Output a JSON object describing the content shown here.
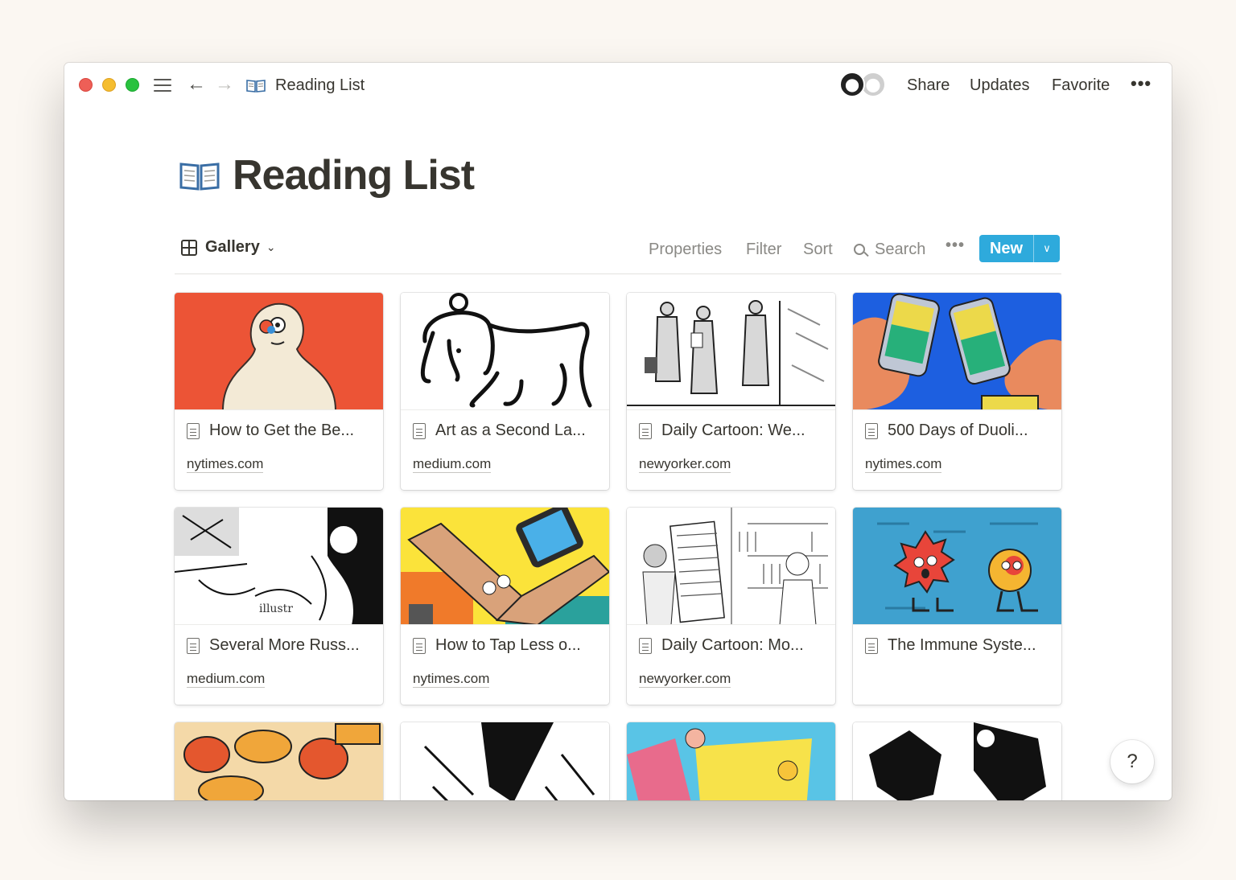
{
  "window": {
    "breadcrumb": "Reading List",
    "top_links": {
      "share": "Share",
      "updates": "Updates",
      "favorite": "Favorite"
    }
  },
  "page": {
    "title": "Reading List",
    "icon": "open-book-icon"
  },
  "toolbar": {
    "view_label": "Gallery",
    "properties": "Properties",
    "filter": "Filter",
    "sort": "Sort",
    "search": "Search",
    "new": "New"
  },
  "colors": {
    "accent": "#2eaadc",
    "window_bg": "#ffffff",
    "desktop_bg": "#fbf7f2"
  },
  "cards": [
    {
      "title": "How to Get the Be...",
      "source": "nytimes.com",
      "cover": "red-snowman-illustration"
    },
    {
      "title": "Art as a Second La...",
      "source": "medium.com",
      "cover": "ink-dog-drawing"
    },
    {
      "title": "Daily Cartoon: We...",
      "source": "newyorker.com",
      "cover": "office-people-cartoon"
    },
    {
      "title": "500 Days of Duoli...",
      "source": "nytimes.com",
      "cover": "phones-cant-speak-illustration"
    },
    {
      "title": "Several More Russ...",
      "source": "medium.com",
      "cover": "sketch-illustrators"
    },
    {
      "title": "How to Tap Less o...",
      "source": "nytimes.com",
      "cover": "arm-phone-illustration"
    },
    {
      "title": "Daily Cartoon: Mo...",
      "source": "newyorker.com",
      "cover": "library-books-cartoon"
    },
    {
      "title": "The Immune Syste...",
      "source": "",
      "cover": "virus-characters-illustration"
    },
    {
      "title": "",
      "source": "",
      "cover": "food-illustration"
    },
    {
      "title": "",
      "source": "",
      "cover": "black-white-abstract"
    },
    {
      "title": "",
      "source": "",
      "cover": "colorful-people-illustration"
    },
    {
      "title": "",
      "source": "",
      "cover": "black-splatter-figure"
    }
  ],
  "help": "?"
}
